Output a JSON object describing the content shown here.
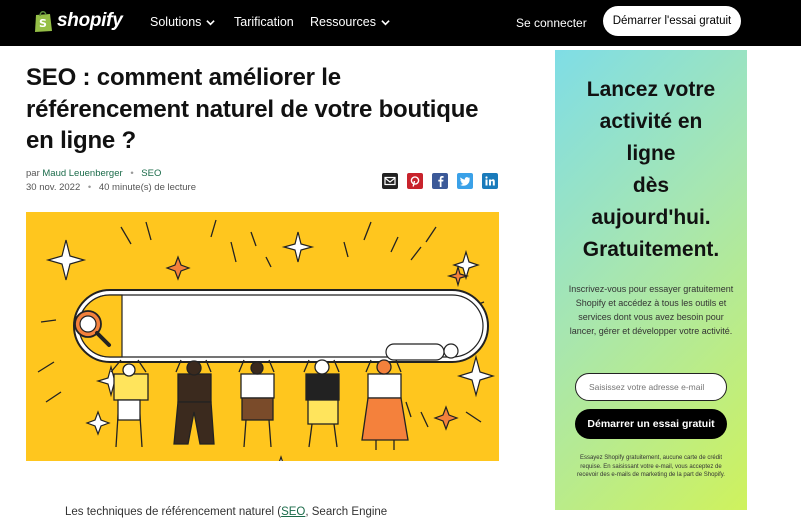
{
  "nav": {
    "logo_text": "shopify",
    "items": [
      {
        "label": "Solutions",
        "has_dropdown": true
      },
      {
        "label": "Tarification",
        "has_dropdown": false
      },
      {
        "label": "Ressources",
        "has_dropdown": true
      }
    ],
    "login": "Se connecter",
    "cta": "Démarrer l'essai gratuit"
  },
  "article": {
    "title": "SEO : comment améliorer le référencement naturel de votre boutique en ligne ?",
    "by": "par",
    "author": "Maud Leuenberger",
    "category": "SEO",
    "date": "30 nov. 2022",
    "read_time": "40 minute(s) de lecture",
    "share_icons": [
      "email-icon",
      "pinterest-icon",
      "facebook-icon",
      "twitter-icon",
      "linkedin-icon"
    ],
    "body_start": "Les techniques de référencement naturel (",
    "body_link": "SEO",
    "body_end": ", Search Engine"
  },
  "sidebar": {
    "headline": [
      "Lancez votre",
      "activité en",
      "ligne",
      "dès",
      "aujourd'hui.",
      "Gratuitement."
    ],
    "description": "Inscrivez-vous pour essayer gratuitement Shopify et accédez à tous les outils et services dont vous avez besoin pour lancer, gérer et développer votre activité.",
    "email_placeholder": "Saisissez votre adresse e-mail",
    "cta": "Démarrer un essai gratuit",
    "fine_print": "Essayez Shopify gratuitement, aucune carte de crédit requise. En saisissant votre e-mail, vous acceptez de recevoir des e-mails de marketing de la part de Shopify."
  },
  "colors": {
    "nav_bg": "#000000",
    "hero_bg": "#ffc61e",
    "link": "#1b6b4a",
    "sidebar_gradient": [
      "#7fdde6",
      "#cff25d"
    ]
  }
}
